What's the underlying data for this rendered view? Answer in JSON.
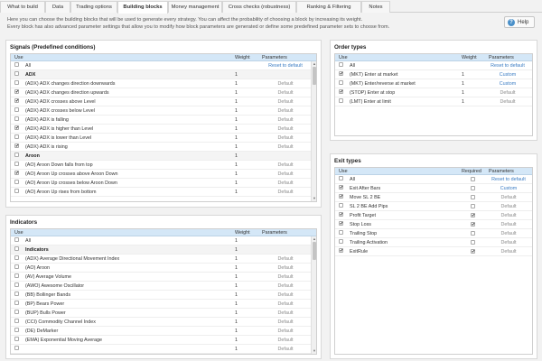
{
  "tabs": [
    "What to build",
    "Data",
    "Trading options",
    "Building blocks",
    "Money management",
    "Cross checks (robustness)",
    "Ranking & Filtering",
    "Notes"
  ],
  "active_tab": "Building blocks",
  "description": {
    "line1": "Here you can choose the building blocks that will be used to generate every strategy. You can affect the probability of choosing a block by increasing its weight.",
    "line2": "Every block has also advanced parameter settings that allow you to modify how block parameters are generated or define some predefined parameter sets to choose from."
  },
  "help_label": "Help",
  "signals": {
    "title": "Signals (Predefined conditions)",
    "headers": {
      "use": "Use",
      "weight": "Weight",
      "params": "Parameters"
    },
    "rows": [
      {
        "checked": false,
        "name": "All",
        "weight": "",
        "params": "Reset to default",
        "group": false
      },
      {
        "checked": false,
        "name": "ADX",
        "weight": "1",
        "params": "",
        "group": true
      },
      {
        "checked": false,
        "name": "(ADX) ADX changes direction downwards",
        "weight": "1",
        "params": "Default",
        "group": false
      },
      {
        "checked": true,
        "name": "(ADX) ADX changes direction upwards",
        "weight": "1",
        "params": "Default",
        "group": false
      },
      {
        "checked": true,
        "name": "(ADX) ADX crosses above Level",
        "weight": "1",
        "params": "Default",
        "group": false
      },
      {
        "checked": false,
        "name": "(ADX) ADX crosses below Level",
        "weight": "1",
        "params": "Default",
        "group": false
      },
      {
        "checked": false,
        "name": "(ADX) ADX is falling",
        "weight": "1",
        "params": "Default",
        "group": false
      },
      {
        "checked": true,
        "name": "(ADX) ADX is higher than Level",
        "weight": "1",
        "params": "Default",
        "group": false
      },
      {
        "checked": false,
        "name": "(ADX) ADX is lower than Level",
        "weight": "1",
        "params": "Default",
        "group": false
      },
      {
        "checked": true,
        "name": "(ADX) ADX is rising",
        "weight": "1",
        "params": "Default",
        "group": false
      },
      {
        "checked": false,
        "name": "Aroon",
        "weight": "1",
        "params": "",
        "group": true
      },
      {
        "checked": false,
        "name": "(AO) Aroon Down falls from top",
        "weight": "1",
        "params": "Default",
        "group": false
      },
      {
        "checked": true,
        "name": "(AO) Aroon Up crosses above Aroon Down",
        "weight": "1",
        "params": "Default",
        "group": false
      },
      {
        "checked": false,
        "name": "(AO) Aroon Up crosses below Aroon Down",
        "weight": "1",
        "params": "Default",
        "group": false
      },
      {
        "checked": false,
        "name": "(AO) Aroon Up rises from bottom",
        "weight": "1",
        "params": "Default",
        "group": false
      }
    ]
  },
  "indicators": {
    "title": "Indicators",
    "headers": {
      "use": "Use",
      "weight": "Weight",
      "params": "Parameters"
    },
    "rows": [
      {
        "checked": false,
        "name": "All",
        "weight": "1",
        "params": "",
        "group": false
      },
      {
        "checked": false,
        "name": "Indicators",
        "weight": "1",
        "params": "",
        "group": true
      },
      {
        "checked": false,
        "name": "(ADX) Average Directional Movement Index",
        "weight": "1",
        "params": "Default",
        "group": false
      },
      {
        "checked": false,
        "name": "(AO) Aroon",
        "weight": "1",
        "params": "Default",
        "group": false
      },
      {
        "checked": false,
        "name": "(AV) Average Volume",
        "weight": "1",
        "params": "Default",
        "group": false
      },
      {
        "checked": false,
        "name": "(AWO) Awesome Oscillator",
        "weight": "1",
        "params": "Default",
        "group": false
      },
      {
        "checked": false,
        "name": "(BB) Bollinger Bands",
        "weight": "1",
        "params": "Default",
        "group": false
      },
      {
        "checked": false,
        "name": "(BP) Bears Power",
        "weight": "1",
        "params": "Default",
        "group": false
      },
      {
        "checked": false,
        "name": "(BUP) Bulls Power",
        "weight": "1",
        "params": "Default",
        "group": false
      },
      {
        "checked": false,
        "name": "(CCI) Commodity Channel Index",
        "weight": "1",
        "params": "Default",
        "group": false
      },
      {
        "checked": false,
        "name": "(DE) DeMarker",
        "weight": "1",
        "params": "Default",
        "group": false
      },
      {
        "checked": false,
        "name": "(EMA) Exponential Moving Average",
        "weight": "1",
        "params": "Default",
        "group": false
      },
      {
        "checked": false,
        "name": "",
        "weight": "1",
        "params": "Default",
        "group": false
      }
    ]
  },
  "order_types": {
    "title": "Order types",
    "headers": {
      "use": "Use",
      "weight": "Weight",
      "params": "Parameters"
    },
    "rows": [
      {
        "checked": false,
        "name": "All",
        "weight": "",
        "params": "Reset to default"
      },
      {
        "checked": true,
        "name": "(MKT) Enter at market",
        "weight": "1",
        "params": "Custom"
      },
      {
        "checked": false,
        "name": "(MKT) Enter/reverse at market",
        "weight": "1",
        "params": "Custom"
      },
      {
        "checked": true,
        "name": "(STOP) Enter at stop",
        "weight": "1",
        "params": "Default"
      },
      {
        "checked": false,
        "name": "(LMT) Enter at limit",
        "weight": "1",
        "params": "Default"
      }
    ]
  },
  "exit_types": {
    "title": "Exit types",
    "headers": {
      "use": "Use",
      "required": "Required",
      "params": "Parameters"
    },
    "rows": [
      {
        "checked": false,
        "name": "All",
        "required": false,
        "params": "Reset to default"
      },
      {
        "checked": true,
        "name": "Exit After Bars",
        "required": false,
        "params": "Custom"
      },
      {
        "checked": true,
        "name": "Move SL 2 BE",
        "required": false,
        "params": "Default"
      },
      {
        "checked": false,
        "name": "SL 2 BE Add Pips",
        "required": false,
        "params": "Default"
      },
      {
        "checked": true,
        "name": "Profit Target",
        "required": true,
        "params": "Default"
      },
      {
        "checked": true,
        "name": "Stop Loss",
        "required": true,
        "params": "Default"
      },
      {
        "checked": false,
        "name": "Trailing Stop",
        "required": false,
        "params": "Default"
      },
      {
        "checked": false,
        "name": "Trailing Activation",
        "required": false,
        "params": "Default"
      },
      {
        "checked": true,
        "name": "ExitRule",
        "required": true,
        "params": "Default"
      }
    ]
  },
  "colors": {
    "header": "#d4e7f7",
    "link": "#3a7cc3",
    "accent": "#4a90c9"
  }
}
